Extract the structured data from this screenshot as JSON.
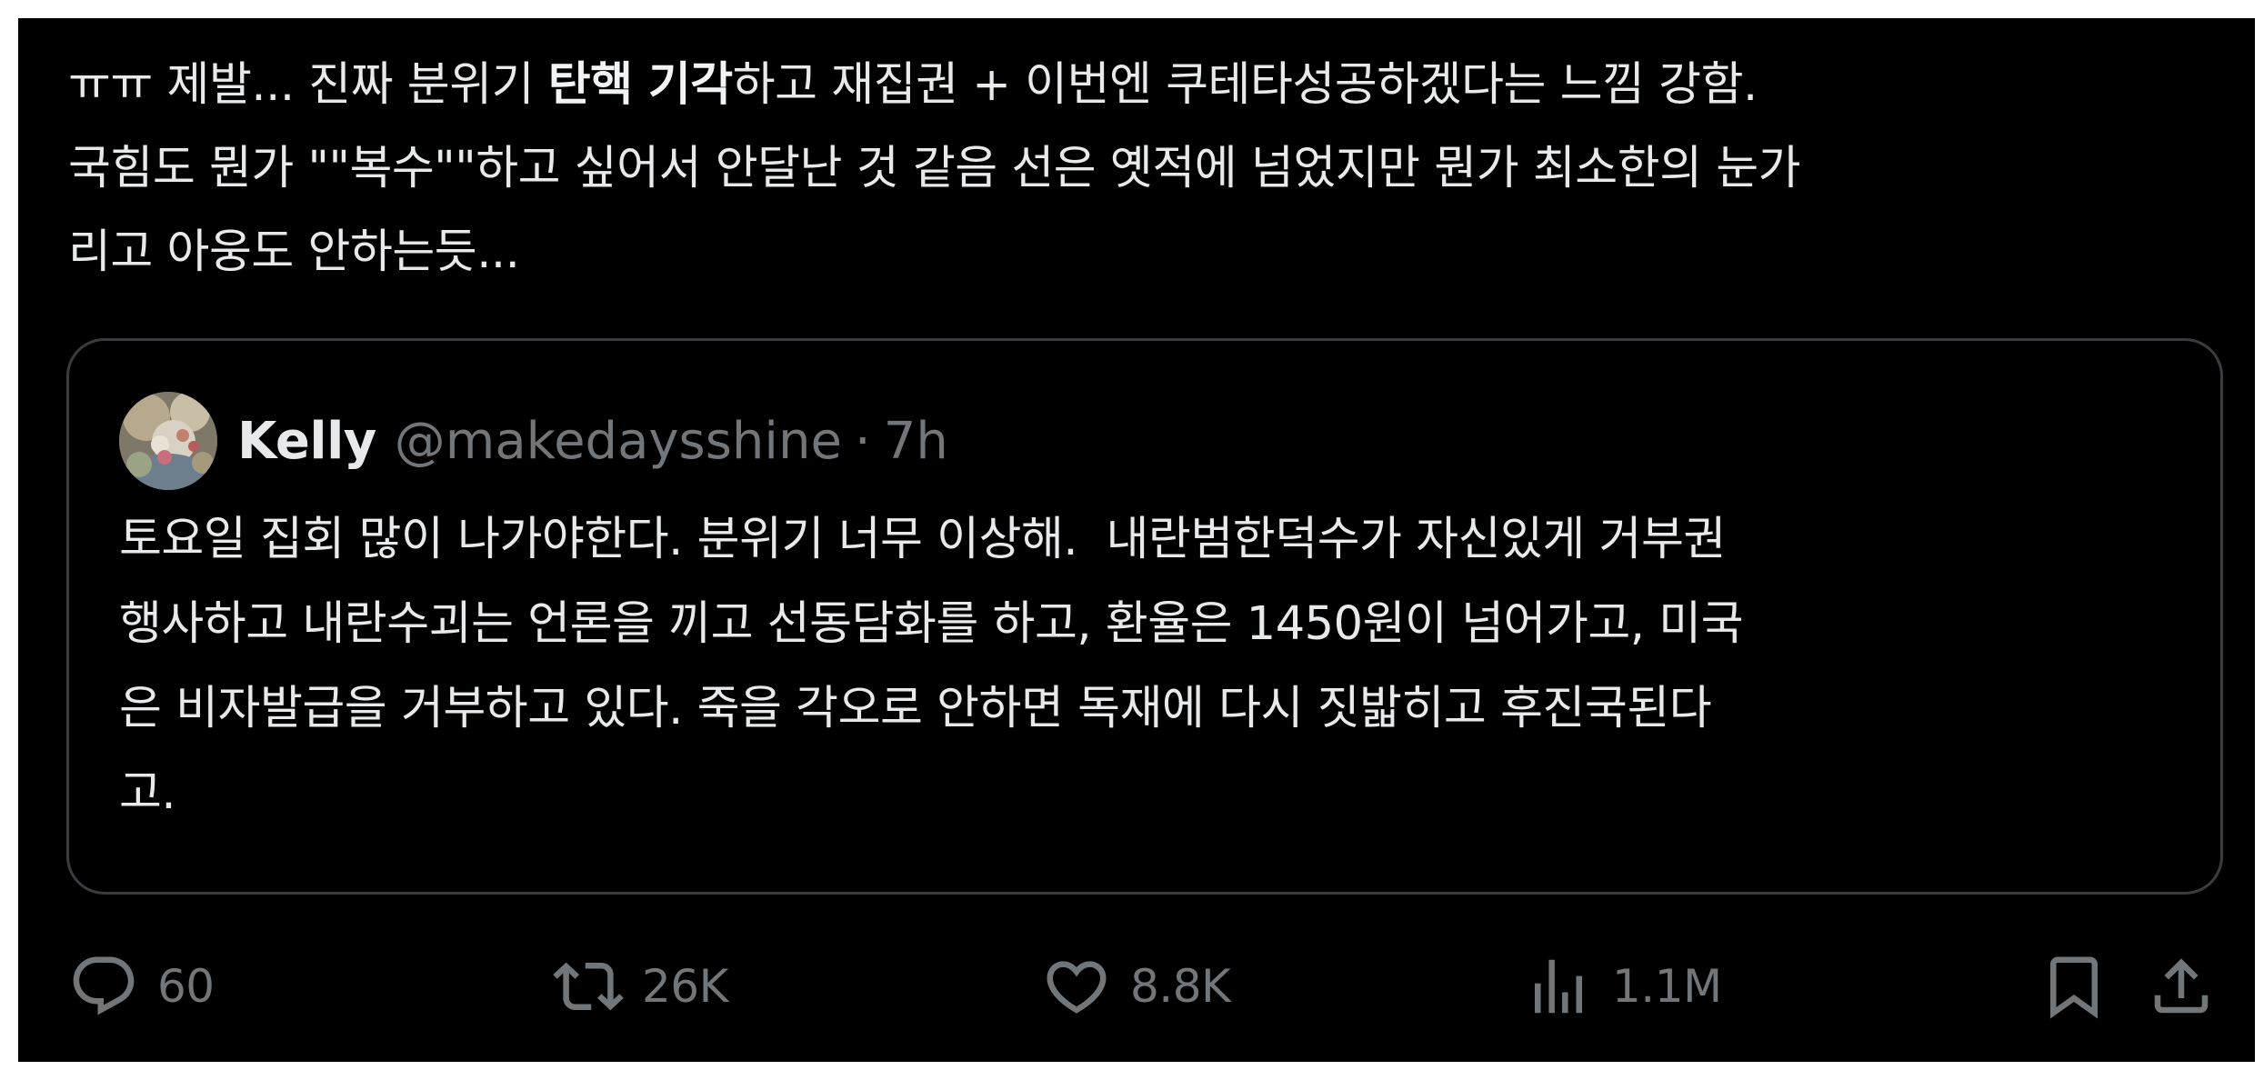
{
  "tweet": {
    "text_lines": [
      [
        {
          "text": "ㅠㅠ 제발... 진짜 분위기 ",
          "bold": false
        },
        {
          "text": "탄핵 기각",
          "bold": true
        },
        {
          "text": "하고 재집권 + 이번엔 쿠테타성공하겠다는 느낌 강함.",
          "bold": false
        }
      ],
      [
        {
          "text": "국힘도 뭔가 \"\"복수\"\"하고 싶어서 안달난 것 같음 선은 옛적에 넘었지만 뭔가 최소한의 눈가",
          "bold": false
        }
      ],
      [
        {
          "text": "리고 아웅도 안하는듯...",
          "bold": false
        }
      ]
    ]
  },
  "quote": {
    "author_name": "Kelly",
    "author_handle": "@makedaysshine",
    "separator": "·",
    "timestamp": "7h",
    "text_lines": [
      "토요일 집회 많이 나가야한다. 분위기 너무 이상해.  내란범한덕수가 자신있게 거부권",
      "행사하고 내란수괴는 언론을 끼고 선동담화를 하고, 환율은 1450원이 넘어가고, 미국",
      "은 비자발급을 거부하고 있다. 죽을 각오로 안하면 독재에 다시 짓밟히고 후진국된다",
      "고."
    ]
  },
  "actions": {
    "reply": {
      "icon": "reply-icon",
      "count": "60"
    },
    "repost": {
      "icon": "repost-icon",
      "count": "26K"
    },
    "like": {
      "icon": "heart-icon",
      "count": "8.8K"
    },
    "views": {
      "icon": "views-icon",
      "count": "1.1M"
    },
    "bookmark": {
      "icon": "bookmark-icon"
    },
    "share": {
      "icon": "share-icon"
    }
  },
  "colors": {
    "background": "#000000",
    "text": "#e7e9ea",
    "muted": "#71767b",
    "border": "#3a3d40"
  }
}
